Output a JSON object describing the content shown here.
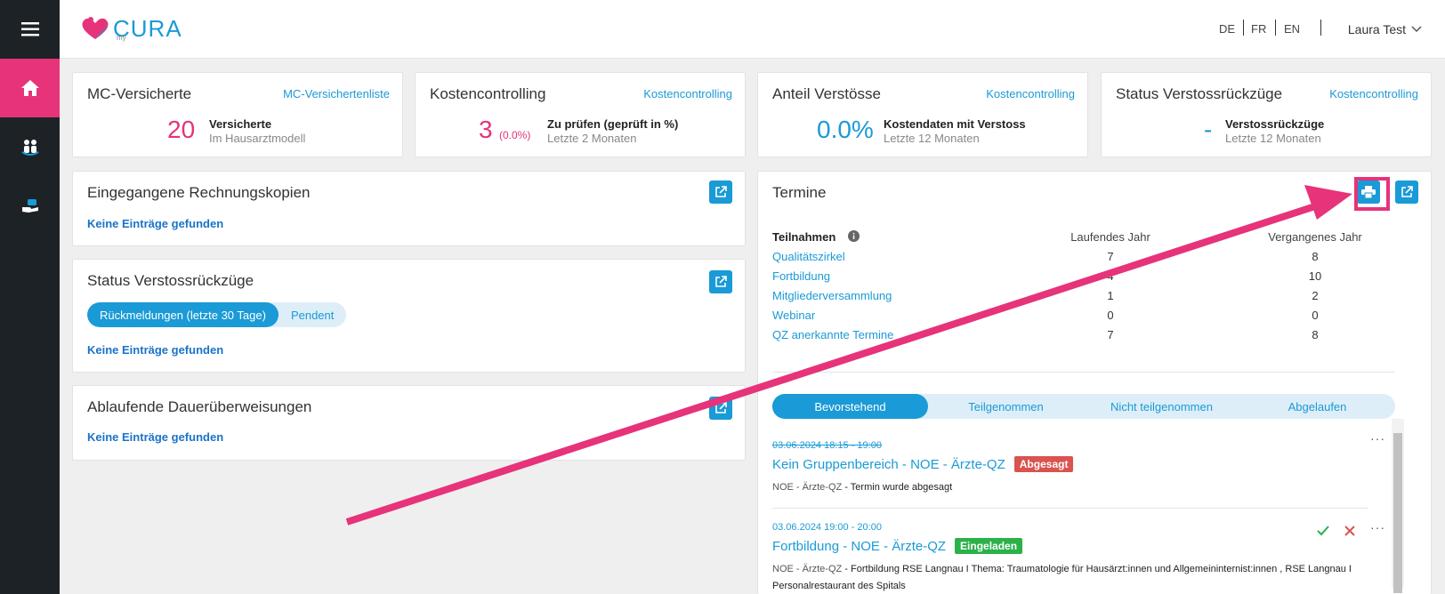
{
  "header": {
    "logo_small": "my",
    "logo_text": "CURA",
    "languages": [
      "DE",
      "FR",
      "EN"
    ],
    "user": "Laura Test"
  },
  "sidebar": {
    "items": [
      {
        "icon": "menu-icon"
      },
      {
        "icon": "home-icon",
        "active": true
      },
      {
        "icon": "people-icon"
      },
      {
        "icon": "hand-care-icon"
      }
    ]
  },
  "cards": {
    "mc": {
      "title": "MC-Versicherte",
      "link": "MC-Versichertenliste",
      "value": "20",
      "label": "Versicherte",
      "sublabel": "Im Hausarztmodell"
    },
    "kosten": {
      "title": "Kostencontrolling",
      "link": "Kostencontrolling",
      "value": "3",
      "subvalue": "(0.0%)",
      "label": "Zu prüfen (geprüft in %)",
      "sublabel": "Letzte 2 Monaten"
    },
    "anteil": {
      "title": "Anteil Verstösse",
      "link": "Kostencontrolling",
      "value": "0.0%",
      "label": "Kostendaten mit Verstoss",
      "sublabel": "Letzte 12 Monaten"
    },
    "status": {
      "title": "Status Verstossrückzüge",
      "link": "Kostencontrolling",
      "value": "-",
      "label": "Verstossrückzüge",
      "sublabel": "Letzte 12 Monaten"
    }
  },
  "panels": {
    "rechnung": {
      "title": "Eingegangene Rechnungskopien",
      "empty": "Keine Einträge gefunden"
    },
    "verstoss": {
      "title": "Status Verstossrückzüge",
      "seg_on": "Rückmeldungen (letzte 30 Tage)",
      "seg_off": "Pendent",
      "empty": "Keine Einträge gefunden"
    },
    "dauer": {
      "title": "Ablaufende Dauerüberweisungen",
      "empty": "Keine Einträge gefunden"
    }
  },
  "termine": {
    "title": "Termine",
    "col_name": "Teilnahmen",
    "col_a": "Laufendes Jahr",
    "col_b": "Vergangenes Jahr",
    "rows": [
      {
        "name": "Qualitätszirkel",
        "a": "7",
        "b": "8"
      },
      {
        "name": "Fortbildung",
        "a": "4",
        "b": "10"
      },
      {
        "name": "Mitgliederversammlung",
        "a": "1",
        "b": "2"
      },
      {
        "name": "Webinar",
        "a": "0",
        "b": "0"
      },
      {
        "name": "QZ anerkannte Termine",
        "a": "7",
        "b": "8"
      }
    ],
    "tabs": [
      "Bevorstehend",
      "Teilgenommen",
      "Nicht teilgenommen",
      "Abgelaufen"
    ],
    "events": [
      {
        "date": "03.06.2024 18:15 - 19:00",
        "title": "Kein Gruppenbereich - NOE - Ärzte-QZ",
        "badge": "Abgesagt",
        "badge_color": "#d9534f",
        "group": "NOE - Ärzte-QZ",
        "desc": " - Termin wurde abgesagt"
      },
      {
        "date": "03.06.2024 19:00 - 20:00",
        "title": "Fortbildung - NOE - Ärzte-QZ",
        "badge": "Eingeladen",
        "badge_color": "#2bb14a",
        "group": "NOE - Ärzte-QZ",
        "desc": " - Fortbildung RSE Langnau I Thema: Traumatologie für Hausärzt:innen und Allgemeininternist:innen , RSE Langnau I Personalrestaurant des Spitals"
      }
    ]
  },
  "colors": {
    "brand_pink": "#e6337a",
    "brand_blue": "#1a9ad6",
    "sidebar": "#1d2227"
  }
}
